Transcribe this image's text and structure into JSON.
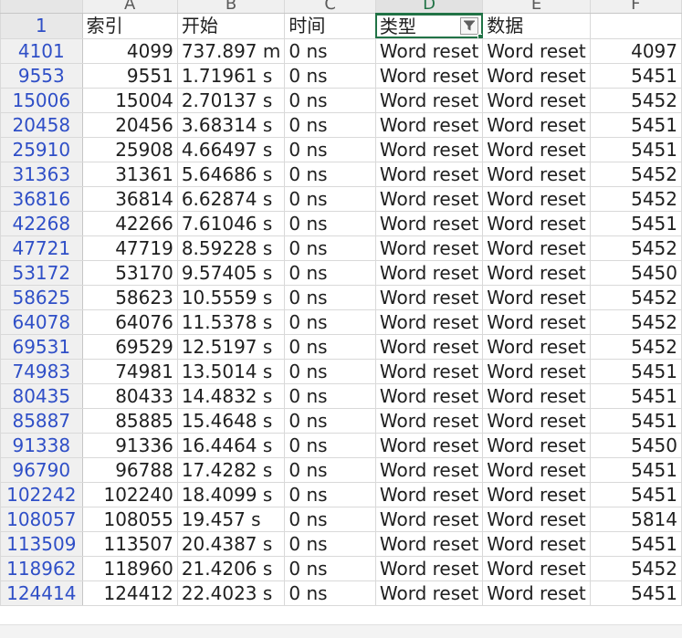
{
  "columns": [
    "A",
    "B",
    "C",
    "D",
    "E",
    "F"
  ],
  "selected_column": "D",
  "header_row": {
    "row_number": "1",
    "cells": [
      "索引",
      "开始",
      "时间",
      "类型",
      "数据",
      ""
    ]
  },
  "rows": [
    {
      "row": "4101",
      "a": "4099",
      "b": "737.897 m",
      "c": "0 ns",
      "d": "Word reset",
      "e": "Word reset",
      "f": "4097"
    },
    {
      "row": "9553",
      "a": "9551",
      "b": "1.71961 s",
      "c": "0 ns",
      "d": "Word reset",
      "e": "Word reset",
      "f": "5451"
    },
    {
      "row": "15006",
      "a": "15004",
      "b": "2.70137 s",
      "c": "0 ns",
      "d": "Word reset",
      "e": "Word reset",
      "f": "5452"
    },
    {
      "row": "20458",
      "a": "20456",
      "b": "3.68314 s",
      "c": "0 ns",
      "d": "Word reset",
      "e": "Word reset",
      "f": "5451"
    },
    {
      "row": "25910",
      "a": "25908",
      "b": "4.66497 s",
      "c": "0 ns",
      "d": "Word reset",
      "e": "Word reset",
      "f": "5451"
    },
    {
      "row": "31363",
      "a": "31361",
      "b": "5.64686 s",
      "c": "0 ns",
      "d": "Word reset",
      "e": "Word reset",
      "f": "5452"
    },
    {
      "row": "36816",
      "a": "36814",
      "b": "6.62874 s",
      "c": "0 ns",
      "d": "Word reset",
      "e": "Word reset",
      "f": "5452"
    },
    {
      "row": "42268",
      "a": "42266",
      "b": "7.61046 s",
      "c": "0 ns",
      "d": "Word reset",
      "e": "Word reset",
      "f": "5451"
    },
    {
      "row": "47721",
      "a": "47719",
      "b": "8.59228 s",
      "c": "0 ns",
      "d": "Word reset",
      "e": "Word reset",
      "f": "5452"
    },
    {
      "row": "53172",
      "a": "53170",
      "b": "9.57405 s",
      "c": "0 ns",
      "d": "Word reset",
      "e": "Word reset",
      "f": "5450"
    },
    {
      "row": "58625",
      "a": "58623",
      "b": "10.5559 s",
      "c": "0 ns",
      "d": "Word reset",
      "e": "Word reset",
      "f": "5452"
    },
    {
      "row": "64078",
      "a": "64076",
      "b": "11.5378 s",
      "c": "0 ns",
      "d": "Word reset",
      "e": "Word reset",
      "f": "5452"
    },
    {
      "row": "69531",
      "a": "69529",
      "b": "12.5197 s",
      "c": "0 ns",
      "d": "Word reset",
      "e": "Word reset",
      "f": "5452"
    },
    {
      "row": "74983",
      "a": "74981",
      "b": "13.5014 s",
      "c": "0 ns",
      "d": "Word reset",
      "e": "Word reset",
      "f": "5451"
    },
    {
      "row": "80435",
      "a": "80433",
      "b": "14.4832 s",
      "c": "0 ns",
      "d": "Word reset",
      "e": "Word reset",
      "f": "5451"
    },
    {
      "row": "85887",
      "a": "85885",
      "b": "15.4648 s",
      "c": "0 ns",
      "d": "Word reset",
      "e": "Word reset",
      "f": "5451"
    },
    {
      "row": "91338",
      "a": "91336",
      "b": "16.4464 s",
      "c": "0 ns",
      "d": "Word reset",
      "e": "Word reset",
      "f": "5450"
    },
    {
      "row": "96790",
      "a": "96788",
      "b": "17.4282 s",
      "c": "0 ns",
      "d": "Word reset",
      "e": "Word reset",
      "f": "5451"
    },
    {
      "row": "102242",
      "a": "102240",
      "b": "18.4099 s",
      "c": "0 ns",
      "d": "Word reset",
      "e": "Word reset",
      "f": "5451"
    },
    {
      "row": "108057",
      "a": "108055",
      "b": "19.457 s",
      "c": "0 ns",
      "d": "Word reset",
      "e": "Word reset",
      "f": "5814"
    },
    {
      "row": "113509",
      "a": "113507",
      "b": "20.4387 s",
      "c": "0 ns",
      "d": "Word reset",
      "e": "Word reset",
      "f": "5451"
    },
    {
      "row": "118962",
      "a": "118960",
      "b": "21.4206 s",
      "c": "0 ns",
      "d": "Word reset",
      "e": "Word reset",
      "f": "5452"
    },
    {
      "row": "124414",
      "a": "124412",
      "b": "22.4023 s",
      "c": "0 ns",
      "d": "Word reset",
      "e": "Word reset",
      "f": "5451"
    }
  ],
  "icons": {
    "filter": "filter-funnel-icon"
  },
  "colors": {
    "accent": "#217346",
    "row_number": "#2f4fc7",
    "header_bg": "#f0f0f0"
  }
}
